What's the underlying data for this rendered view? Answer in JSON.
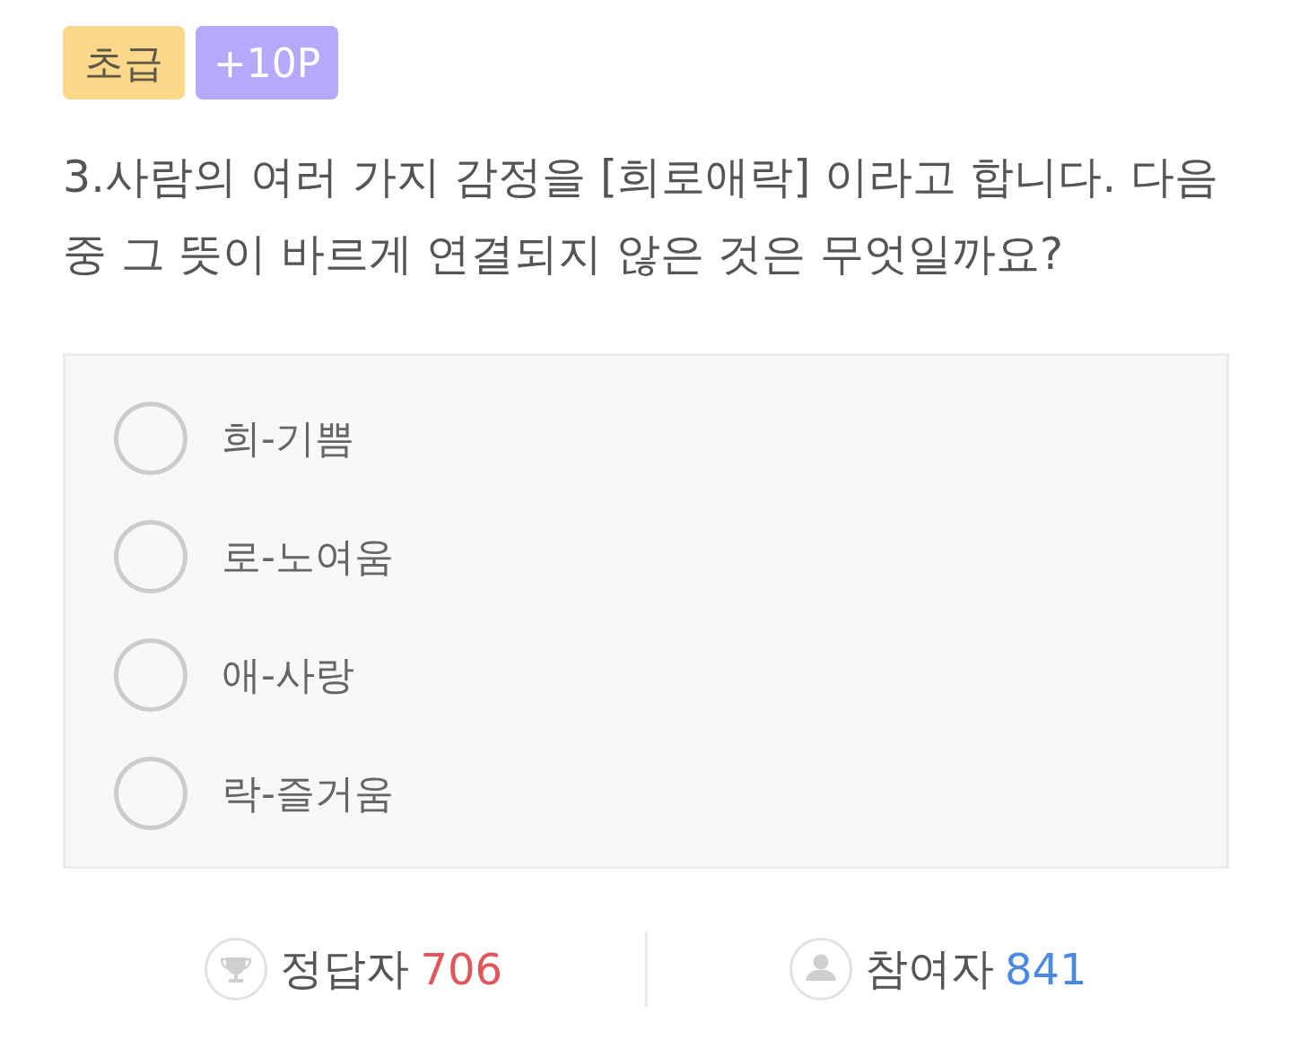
{
  "tags": [
    {
      "kind": "level",
      "label": "초급"
    },
    {
      "kind": "points",
      "label": "+10P"
    }
  ],
  "question": "3.사람의 여러 가지 감정을 [희로애락] 이라고 합니다. 다음 중 그 뜻이 바르게 연결되지 않은 것은 무엇일까요?",
  "options": [
    {
      "label": "희-기쁨",
      "selected": false
    },
    {
      "label": "로-노여움",
      "selected": false
    },
    {
      "label": "애-사랑",
      "selected": false
    },
    {
      "label": "락-즐거움",
      "selected": false
    }
  ],
  "stats": [
    {
      "kind": "correct",
      "label": "정답자",
      "count": "706"
    },
    {
      "kind": "participants",
      "label": "참여자",
      "count": "841"
    }
  ]
}
